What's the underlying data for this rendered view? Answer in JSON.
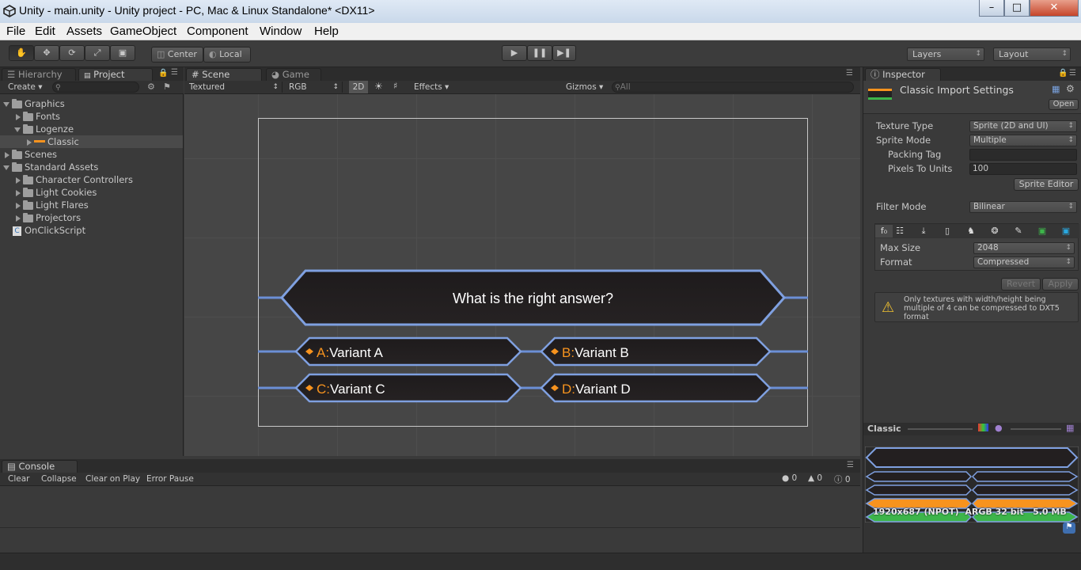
{
  "window": {
    "title": "Unity - main.unity - Unity project - PC, Mac & Linux Standalone* <DX11>",
    "minimize": "–",
    "maximize": "□",
    "close": "✕"
  },
  "menu": [
    "File",
    "Edit",
    "Assets",
    "GameObject",
    "Component",
    "Window",
    "Help"
  ],
  "toolbar": {
    "pivot": "Center",
    "space": "Local",
    "layers": "Layers",
    "layout": "Layout"
  },
  "project_panel": {
    "tabs": {
      "hierarchy": "Hierarchy",
      "project": "Project"
    },
    "create": "Create",
    "tree": [
      {
        "label": "Graphics"
      },
      {
        "label": "Fonts"
      },
      {
        "label": "Logenze"
      },
      {
        "label": "Classic"
      },
      {
        "label": "Scenes"
      },
      {
        "label": "Standard Assets"
      },
      {
        "label": "Character Controllers"
      },
      {
        "label": "Light Cookies"
      },
      {
        "label": "Light Flares"
      },
      {
        "label": "Projectors"
      },
      {
        "label": "OnClickScript"
      }
    ]
  },
  "scene_panel": {
    "tabs": {
      "scene": "Scene",
      "game": "Game"
    },
    "toolbar": {
      "draw_mode": "Textured",
      "render_mode": "RGB",
      "mode_2d": "2D",
      "effects": "Effects",
      "gizmos": "Gizmos",
      "search_placeholder": "All"
    },
    "quiz": {
      "question": "What is the right answer?",
      "answers": [
        {
          "letter": "A:",
          "text": "Variant A"
        },
        {
          "letter": "B:",
          "text": "Variant B"
        },
        {
          "letter": "C:",
          "text": "Variant C"
        },
        {
          "letter": "D:",
          "text": "Variant D"
        }
      ]
    }
  },
  "console": {
    "tab": "Console",
    "buttons": [
      "Clear",
      "Collapse",
      "Clear on Play",
      "Error Pause"
    ],
    "counts": {
      "errors": "0",
      "warnings": "0",
      "messages": "0"
    }
  },
  "inspector": {
    "tab": "Inspector",
    "header": "Classic Import Settings",
    "open": "Open",
    "fields": {
      "texture_type_label": "Texture Type",
      "texture_type": "Sprite (2D and UI)",
      "sprite_mode_label": "Sprite Mode",
      "sprite_mode": "Multiple",
      "packing_tag_label": "Packing Tag",
      "packing_tag": "",
      "pixels_to_units_label": "Pixels To Units",
      "pixels_to_units": "100",
      "sprite_editor": "Sprite Editor",
      "filter_mode_label": "Filter Mode",
      "filter_mode": "Bilinear",
      "max_size_label": "Max Size",
      "max_size": "2048",
      "format_label": "Format",
      "format": "Compressed"
    },
    "revert": "Revert",
    "apply": "Apply",
    "warning": "Only textures with width/height being multiple of 4 can be compressed to DXT5 format",
    "preview": {
      "title": "Classic",
      "info": "1920x687 (NPOT)  ARGB 32 bit   5.0 MB"
    }
  },
  "colors": {
    "accent_blue": "#6b8fd6",
    "orange": "#f7931e",
    "green": "#3db54a",
    "dark_plate": "#231f20"
  }
}
